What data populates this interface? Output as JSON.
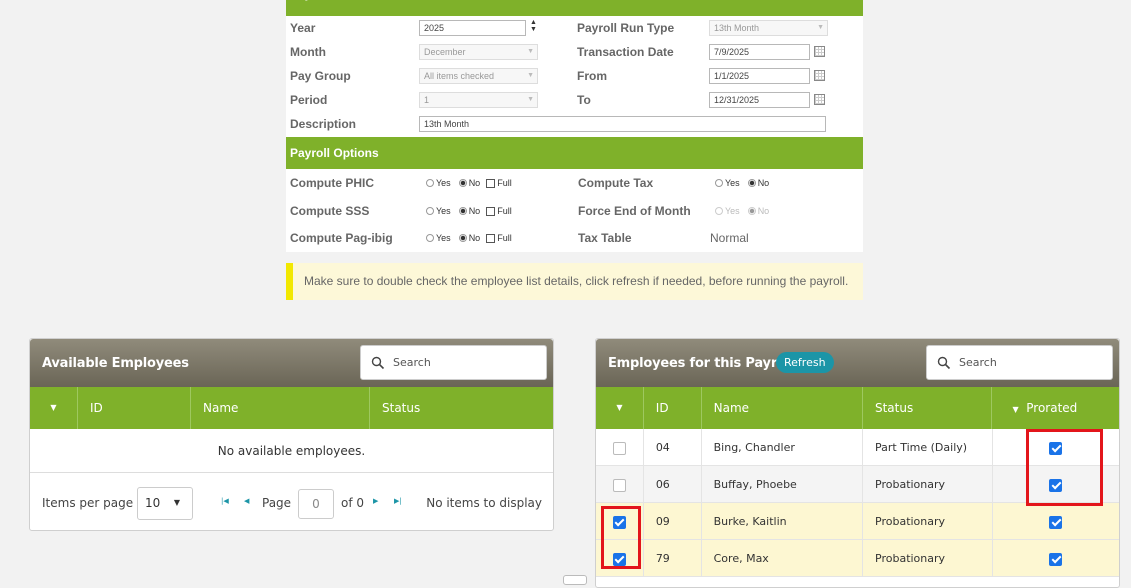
{
  "payroll_period": {
    "title": "Payroll Period",
    "fields": {
      "year": {
        "label": "Year",
        "value": "2025"
      },
      "month": {
        "label": "Month",
        "value": "December"
      },
      "pay_group": {
        "label": "Pay Group",
        "value": "All items checked"
      },
      "period": {
        "label": "Period",
        "value": "1"
      },
      "description": {
        "label": "Description",
        "value": "13th Month"
      },
      "run_type": {
        "label": "Payroll Run Type",
        "value": "13th Month"
      },
      "transaction_date": {
        "label": "Transaction Date",
        "value": "7/9/2025"
      },
      "from": {
        "label": "From",
        "value": "1/1/2025"
      },
      "to": {
        "label": "To",
        "value": "12/31/2025"
      }
    }
  },
  "payroll_options": {
    "title": "Payroll Options",
    "yes": "Yes",
    "no": "No",
    "full": "Full",
    "compute_phic": "Compute PHIC",
    "compute_sss": "Compute SSS",
    "compute_pagibig": "Compute Pag-ibig",
    "compute_tax": "Compute Tax",
    "force_eom": "Force End of Month",
    "tax_table_label": "Tax Table",
    "tax_table_value": "Normal"
  },
  "notice": "Make sure to double check the employee list details, click refresh if needed, before running the payroll.",
  "available": {
    "title": "Available Employees",
    "search_placeholder": "Search",
    "columns": [
      "ID",
      "Name",
      "Status"
    ],
    "empty": "No available employees.",
    "items_per_page_label": "Items per page",
    "items_per_page": "10",
    "page_label": "Page",
    "page": "0",
    "of": "of 0",
    "no_items": "No items to display"
  },
  "payroll_employees": {
    "title": "Employees for this Payroll",
    "refresh": "Refresh",
    "search_placeholder": "Search",
    "columns": [
      "ID",
      "Name",
      "Status",
      "Prorated"
    ],
    "rows": [
      {
        "id": "04",
        "name": "Bing, Chandler",
        "status": "Part Time (Daily)",
        "selected": false,
        "prorated": true
      },
      {
        "id": "06",
        "name": "Buffay, Phoebe",
        "status": "Probationary",
        "selected": false,
        "prorated": true
      },
      {
        "id": "09",
        "name": "Burke, Kaitlin",
        "status": "Probationary",
        "selected": true,
        "prorated": true
      },
      {
        "id": "79",
        "name": "Core, Max",
        "status": "Probationary",
        "selected": true,
        "prorated": true
      }
    ]
  },
  "colors": {
    "accent_green": "#7fb12a",
    "header_gray": "#7a7565",
    "refresh_teal": "#1c95a7",
    "highlight_row": "#fdf7d2",
    "annotation_red": "#e3151b"
  }
}
